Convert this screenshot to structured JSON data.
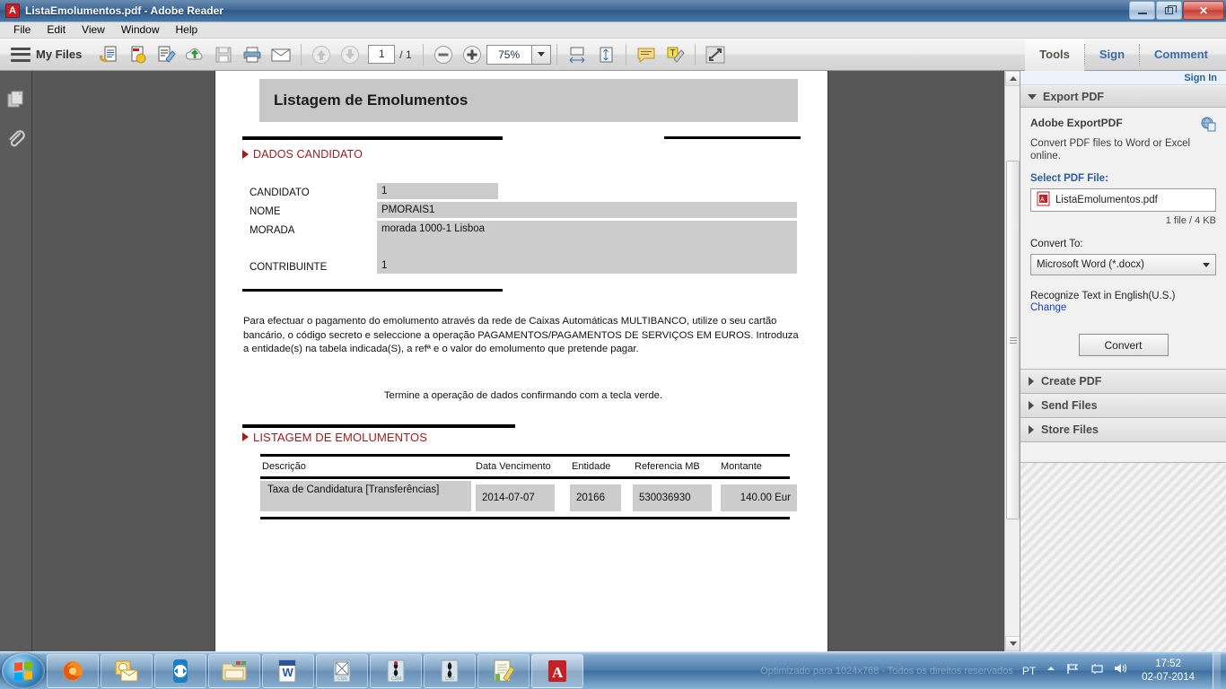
{
  "window": {
    "title": "ListaEmolumentos.pdf - Adobe Reader",
    "app_icon": "pdf-icon",
    "minimize_label": "Minimize",
    "maximize_label": "Maximize",
    "close_label": "✕"
  },
  "menubar": {
    "items": [
      {
        "label": "File"
      },
      {
        "label": "Edit"
      },
      {
        "label": "View"
      },
      {
        "label": "Window"
      },
      {
        "label": "Help"
      }
    ]
  },
  "toolbar": {
    "myfiles_label": "My Files",
    "page_current": "1",
    "page_total": "/ 1",
    "zoom_value": "75%",
    "tools_label": "Tools",
    "sign_label": "Sign",
    "comment_label": "Comment",
    "icons": [
      "open-file-icon",
      "create-pdf-icon",
      "edit-pdf-icon",
      "upload-cloud-icon",
      "save-icon",
      "print-icon",
      "email-icon",
      "previous-page-icon",
      "next-page-icon",
      "zoom-out-icon",
      "zoom-in-icon",
      "fit-width-icon",
      "fit-page-icon",
      "sticky-note-icon",
      "highlight-text-icon",
      "read-mode-icon"
    ]
  },
  "left_rail": {
    "page_thumbnails_label": "Page Thumbnails",
    "attachments_label": "Attachments"
  },
  "document": {
    "title": "Listagem de Emolumentos",
    "section_candidate": "DADOS CANDIDATO",
    "fields": [
      {
        "label": "CANDIDATO",
        "value": "1"
      },
      {
        "label": "NOME",
        "value": "PMORAIS1"
      },
      {
        "label": "MORADA",
        "value": "morada 1000-1 Lisboa"
      },
      {
        "label": "CONTRIBUINTE",
        "value": "1"
      }
    ],
    "paragraph": "Para efectuar o pagamento do emolumento através da rede de Caixas Automáticas MULTIBANCO, utilize o seu cartão bancário, o código secreto e seleccione a operação PAGAMENTOS/PAGAMENTOS DE SERVIÇOS EM EUROS. Introduza a entidade(s) na tabela indicada(S), a refª e o valor do emolumento que pretende pagar.",
    "centered_note": "Termine a operação de dados confirmando com a tecla verde.",
    "section_listing": "LISTAGEM DE EMOLUMENTOS",
    "table": {
      "columns": [
        "Descrição",
        "Data Vencimento",
        "Entidade",
        "Referencia MB",
        "Montante"
      ],
      "rows": [
        {
          "descricao": "Taxa de Candidatura [Transferências]",
          "data_vencimento": "2014-07-07",
          "entidade": "20166",
          "referencia_mb": "530036930",
          "montante": "140.00 Eur"
        }
      ]
    }
  },
  "right_panel": {
    "sign_in": "Sign In",
    "export_pdf": {
      "header": "Export PDF",
      "product_title": "Adobe ExportPDF",
      "product_icon": "export-pdf-globe-icon",
      "description": "Convert PDF files to Word or Excel online.",
      "select_file_label": "Select PDF File:",
      "file_name": "ListaEmolumentos.pdf",
      "file_icon": "pdf-file-icon",
      "file_meta": "1 file / 4 KB",
      "convert_to_label": "Convert To:",
      "convert_to_value": "Microsoft Word (*.docx)",
      "recognize_text": "Recognize Text in English(U.S.)",
      "change_link": "Change",
      "convert_button": "Convert"
    },
    "sections": [
      {
        "label": "Create PDF"
      },
      {
        "label": "Send Files"
      },
      {
        "label": "Store Files"
      }
    ]
  },
  "taskbar": {
    "start_label": "Start",
    "items": [
      {
        "name": "firefox",
        "icon": "firefox-icon"
      },
      {
        "name": "outlook",
        "icon": "outlook-icon"
      },
      {
        "name": "teamviewer",
        "icon": "teamviewer-icon"
      },
      {
        "name": "explorer",
        "icon": "folder-icon"
      },
      {
        "name": "word",
        "icon": "word-icon"
      },
      {
        "name": "editor-css",
        "icon": "css-file-icon"
      },
      {
        "name": "editor-csm",
        "icon": "csm-file-icon"
      },
      {
        "name": "editor-csv",
        "icon": "csv-file-icon"
      },
      {
        "name": "notepad",
        "icon": "notepad-icon"
      },
      {
        "name": "adobe-reader",
        "icon": "acrobat-icon"
      }
    ],
    "tray": {
      "language": "PT",
      "ghost_text": "Optimizado para 1024x768 - Todos os direitos reservados",
      "icons": [
        "show-hidden-icons",
        "network-icon",
        "monitor-icon",
        "volume-icon"
      ],
      "time": "17:52",
      "date": "02-07-2014"
    }
  },
  "colors": {
    "accent_red": "#9b1d1d",
    "link_blue": "#2a5d9f",
    "field_gray": "#cccccc",
    "title_band": "#c7c7c7"
  }
}
